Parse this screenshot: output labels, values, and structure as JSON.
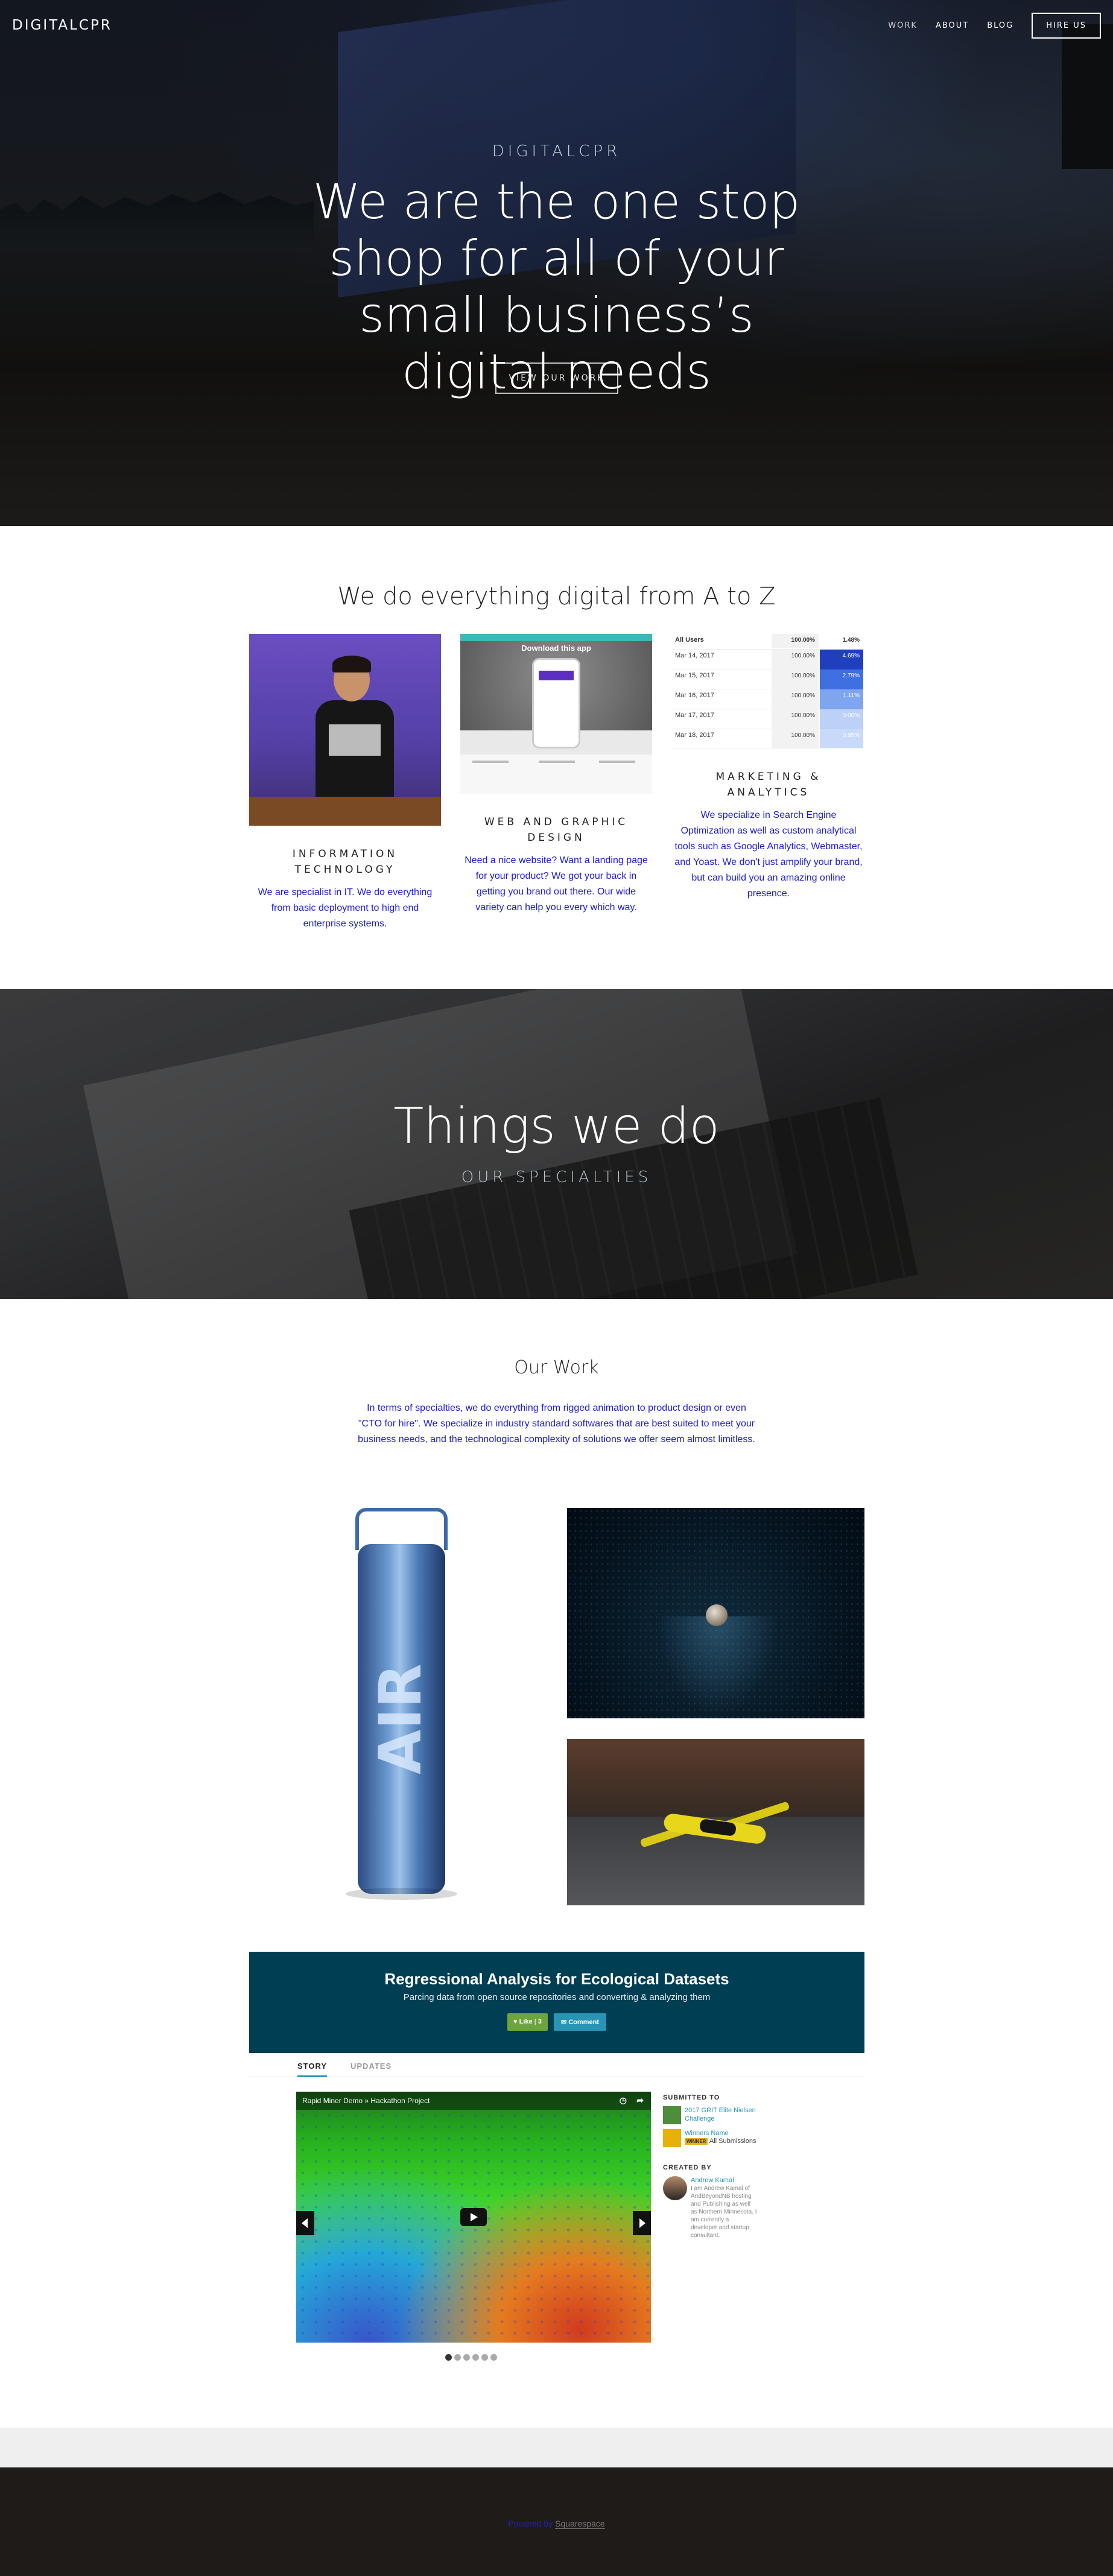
{
  "header": {
    "logo": "DIGITALCPR",
    "nav": [
      "WORK",
      "ABOUT",
      "BLOG"
    ],
    "hire_button": "HIRE US"
  },
  "hero": {
    "subtitle": "DIGITALCPR",
    "title": "We are the one stop shop for all of your small business’s digital needs",
    "button": "VIEW OUR WORK"
  },
  "services": {
    "title": "We do everything digital from A to Z",
    "items": [
      {
        "title": "INFORMATION TECHNOLOGY",
        "text": "We are specialist in IT. We do everything from basic deployment to high end enterprise systems."
      },
      {
        "title": "WEB AND GRAPHIC DESIGN",
        "text": "Need a nice website? Want a landing page for your product? We got your back in getting you brand out there. Our wide variety can help you every which way.",
        "image_caption": "Download this app"
      },
      {
        "title": "MARKETING & ANALYTICS",
        "text": "We specialize in Search Engine Optimization as well as custom analytical tools such as Google Analytics, Webmaster, and Yoast. We don't just amplify your brand, but can build you an amazing online presence.",
        "table": {
          "header": [
            "All Users",
            "100.00%",
            "1.48%"
          ],
          "rows": [
            {
              "date": "Mar 14, 2017",
              "pct": "100.00%",
              "val": "4.69%",
              "color": "#1f3fbf"
            },
            {
              "date": "Mar 15, 2017",
              "pct": "100.00%",
              "val": "2.79%",
              "color": "#3f6fe0"
            },
            {
              "date": "Mar 16, 2017",
              "pct": "100.00%",
              "val": "1.11%",
              "color": "#7fa4f0"
            },
            {
              "date": "Mar 17, 2017",
              "pct": "100.00%",
              "val": "0.00%",
              "color": "#bcd0f8"
            },
            {
              "date": "Mar 18, 2017",
              "pct": "100.00%",
              "val": "0.95%",
              "color": "#c9d9fa"
            }
          ]
        }
      }
    ]
  },
  "specialties": {
    "title": "Things we do",
    "subtitle": "OUR SPECIALTIES"
  },
  "work": {
    "title": "Our Work",
    "description": "In terms of specialties, we do everything from rigged animation to product design or even \"CTO for hire\". We specialize in industry standard softwares that are best suited to meet your business needs, and the technological complexity of solutions we offer seem almost limitless.",
    "can_label": "AIR"
  },
  "devpost": {
    "title": "Regressional Analysis for Ecological Datasets",
    "subtitle": "Parcing data from open source repositories and converting & analyzing them",
    "like": "Like",
    "like_count": "3",
    "comment": "Comment",
    "tabs": [
      "STORY",
      "UPDATES"
    ],
    "video_title": "Rapid Miner Demo » Hackathon Project",
    "submitted_heading": "SUBMITTED TO",
    "submissions": [
      {
        "name": "2017 GRIT Elite Nielsen Challenge"
      },
      {
        "name": "Winners Name",
        "badge": "WINNER",
        "extra": "All Submissions"
      }
    ],
    "created_heading": "CREATED BY",
    "creator": {
      "name": "Andrew Kamal",
      "bio": "I am Andrew Kamal of AndBeyondNB hosting and Publishing as well as Northern Minnesota. I am currently a developer and startup consultant."
    },
    "pager_count": 6
  },
  "footer": {
    "powered": "Powered by",
    "platform": "Squarespace"
  }
}
